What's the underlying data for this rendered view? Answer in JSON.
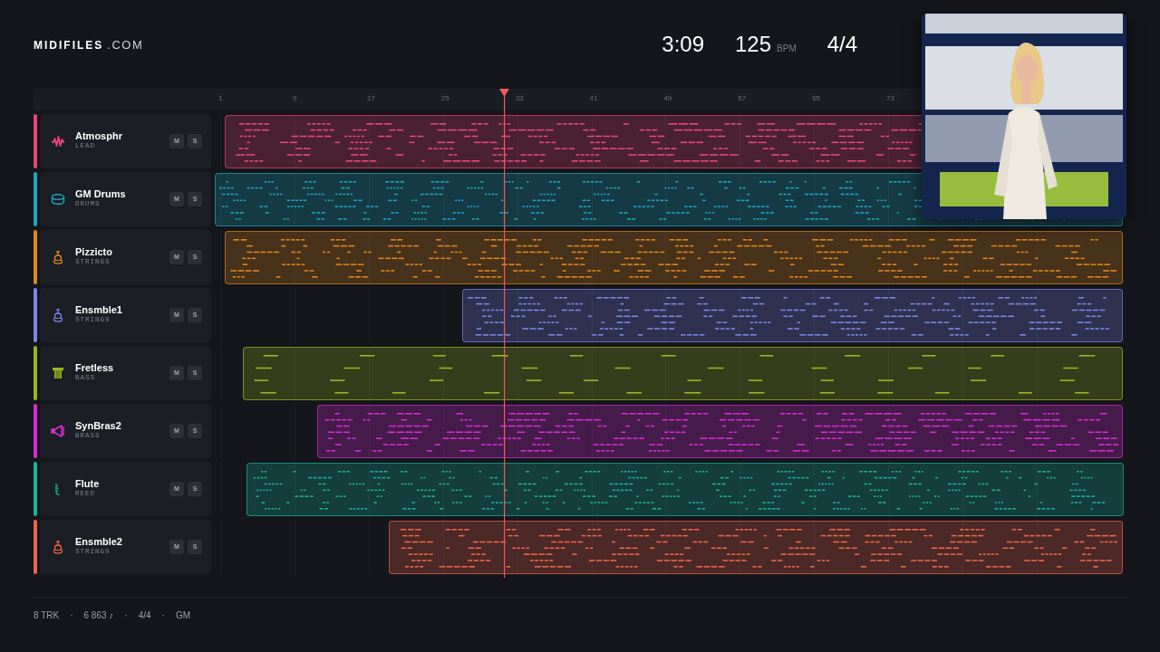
{
  "brand": {
    "name": "MIDIFILES",
    "suffix": ".COM"
  },
  "transport": {
    "time": "3:09",
    "tempo": "125",
    "tempo_unit": "BPM",
    "meter": "4/4"
  },
  "ruler": {
    "labels": [
      "1",
      "9",
      "17",
      "25",
      "33",
      "41",
      "49",
      "57",
      "65",
      "73"
    ]
  },
  "tracks": [
    {
      "name": "Atmosphr",
      "category": "LEAD",
      "kind": "lead",
      "color": "#e8457a",
      "mute": "M",
      "solo": "S"
    },
    {
      "name": "GM Drums",
      "category": "DRUMS",
      "kind": "drums",
      "color": "#1ba6c0",
      "mute": "M",
      "solo": "S"
    },
    {
      "name": "Pizzicto",
      "category": "STRINGS",
      "kind": "strings",
      "color": "#e0861c",
      "mute": "M",
      "solo": "S"
    },
    {
      "name": "Ensmble1",
      "category": "STRINGS",
      "kind": "strings",
      "color": "#7b86e6",
      "mute": "M",
      "solo": "S"
    },
    {
      "name": "Fretless",
      "category": "BASS",
      "kind": "bass",
      "color": "#9cb51f",
      "mute": "M",
      "solo": "S"
    },
    {
      "name": "SynBras2",
      "category": "BRASS",
      "kind": "brass",
      "color": "#d82bd6",
      "mute": "M",
      "solo": "S"
    },
    {
      "name": "Flute",
      "category": "REED",
      "kind": "reed",
      "color": "#17b39a",
      "mute": "M",
      "solo": "S"
    },
    {
      "name": "Ensmble2",
      "category": "STRINGS",
      "kind": "strings",
      "color": "#ef6448",
      "mute": "M",
      "solo": "S"
    }
  ],
  "status_bar": {
    "separator": "·",
    "items": [
      "8 TRK",
      "6 863 ♪",
      "4/4",
      "GM"
    ]
  }
}
